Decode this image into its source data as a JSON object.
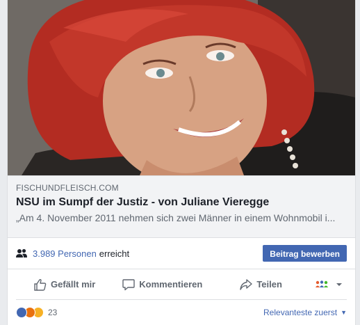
{
  "post": {
    "image_alt": "Portrait photo of a smiling woman with red hair",
    "link": {
      "domain": "FISCHUNDFLEISCH.COM",
      "title": "NSU im Sumpf der Justiz - von Juliane Vieregge",
      "description": "„Am 4. November 2011 nehmen sich zwei Männer in einem Wohnmobil i..."
    },
    "reach": {
      "count_text": "3.989 Personen",
      "suffix": "erreicht",
      "boost_label": "Beitrag bewerben"
    },
    "actions": {
      "like": "Gefällt mir",
      "comment": "Kommentieren",
      "share": "Teilen"
    },
    "reactions": {
      "count": "23",
      "types": [
        "like-icon",
        "angry-icon",
        "wow-icon"
      ],
      "sort_label": "Relevanteste zuerst"
    }
  },
  "colors": {
    "brand": "#4267b2",
    "text_secondary": "#606770",
    "preview_bg": "#f2f3f5"
  }
}
